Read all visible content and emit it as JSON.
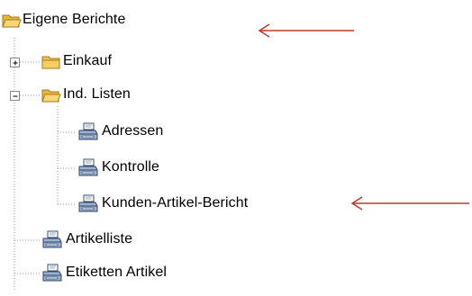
{
  "tree": {
    "root": {
      "label": "Eigene Berichte",
      "icon": "folder-open-icon"
    },
    "items": [
      {
        "label": "Einkauf",
        "icon": "folder-closed-icon",
        "toggle": "+"
      },
      {
        "label": "Ind. Listen",
        "icon": "folder-open-icon",
        "toggle": "−",
        "children": [
          {
            "label": "Adressen",
            "icon": "printer-icon"
          },
          {
            "label": "Kontrolle",
            "icon": "printer-icon"
          },
          {
            "label": "Kunden-Artikel-Bericht",
            "icon": "printer-icon"
          }
        ]
      },
      {
        "label": "Artikelliste",
        "icon": "printer-icon"
      },
      {
        "label": "Etiketten Artikel",
        "icon": "printer-icon"
      }
    ]
  },
  "annotations": [
    {
      "name": "red-arrow-root",
      "color": "#c0392b"
    },
    {
      "name": "red-arrow-kunden",
      "color": "#c0392b"
    }
  ]
}
